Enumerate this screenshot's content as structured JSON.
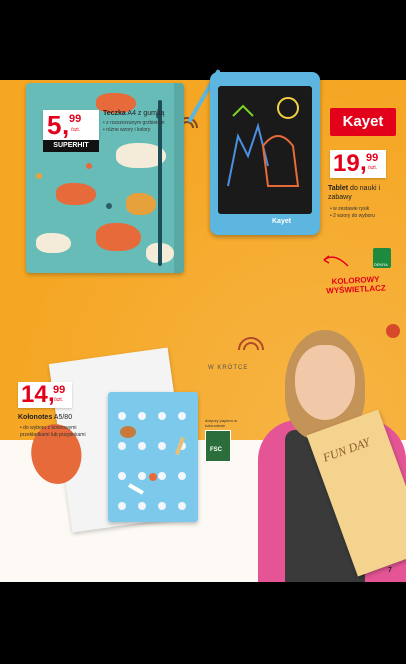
{
  "brand": {
    "name": "Kayet",
    "prefix": ""
  },
  "products": {
    "folder": {
      "name_bold": "Teczka",
      "name_rest": " A4 z gumką",
      "price_main": "5",
      "price_cents": "99",
      "unit": "/szt.",
      "tag": "SUPERHIT",
      "bullets": [
        "z rozszerzanym grzbietem",
        "różne wzory i kolory"
      ]
    },
    "tablet": {
      "name_bold": "Tablet",
      "name_rest": " do nauki i zabawy",
      "price_main": "19",
      "price_cents": "99",
      "unit": "/szt.",
      "brand_on_device": "Kayet",
      "bullets": [
        "w zestawie rysik",
        "2 wzory do wyboru"
      ]
    },
    "notebook": {
      "name_bold": "Kołonotes",
      "name_rest": " A5/80",
      "price_main": "14",
      "price_cents": "99",
      "unit": "/szt.",
      "bullets": [
        "do wyboru z kolorowymi przekładkami lub przypinkami"
      ]
    }
  },
  "callouts": {
    "kolorowy_line1": "KOLOROWY",
    "kolorowy_line2": "WYŚWIETLACZ",
    "wkrotce": "W KRÓTCE",
    "fsc_text": "dotyczy papieru w kołonotesie",
    "fsc_logo": "FSC",
    "dekra": "DEKRA",
    "held_notebook_text": "FUN DAY"
  },
  "page_number": "7",
  "colors": {
    "background": "#f5a623",
    "price_red": "#e3001b",
    "folder_teal": "#67bcb7",
    "tablet_blue": "#5cb6df",
    "shirt_pink": "#e55596"
  }
}
